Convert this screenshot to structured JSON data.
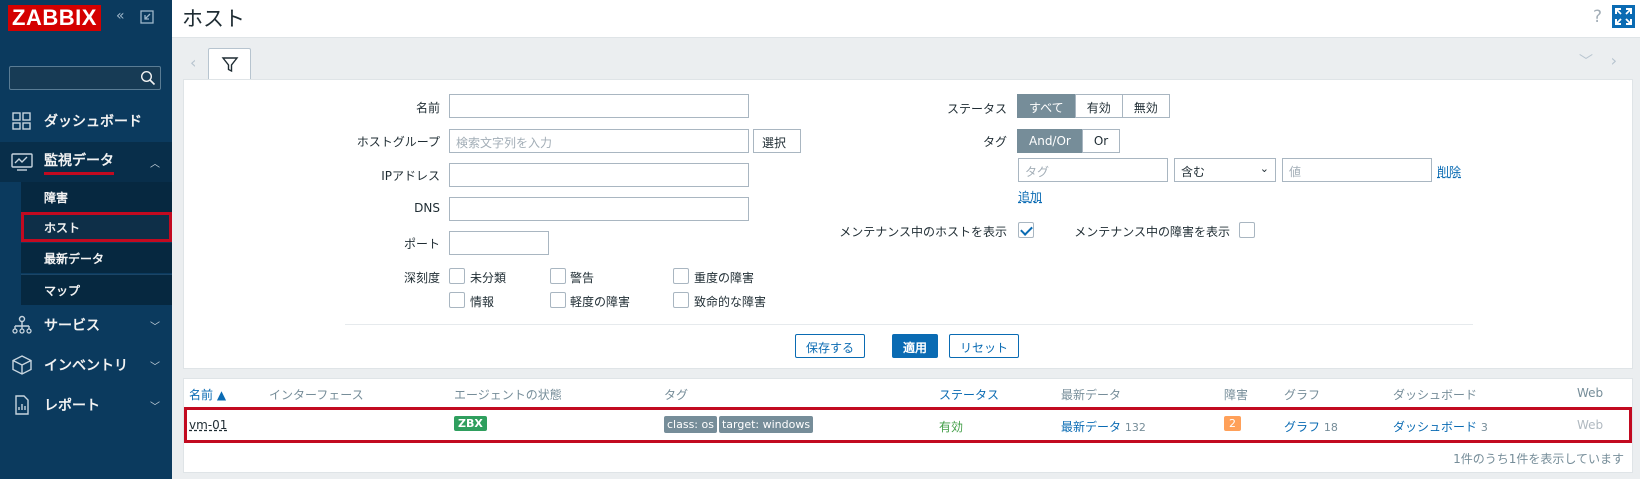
{
  "app": {
    "logo": "ZABBIX",
    "page_title": "ホスト",
    "help": "?"
  },
  "sidebar": {
    "items": [
      {
        "label": "ダッシュボード",
        "icon": "dashboard-icon"
      },
      {
        "label": "監視データ",
        "icon": "monitoring-icon",
        "expanded": true
      },
      {
        "label": "サービス",
        "icon": "services-icon"
      },
      {
        "label": "インベントリ",
        "icon": "inventory-icon"
      },
      {
        "label": "レポート",
        "icon": "reports-icon"
      }
    ],
    "sub_items": [
      {
        "label": "障害"
      },
      {
        "label": "ホスト",
        "current": true
      },
      {
        "label": "最新データ"
      },
      {
        "label": "マップ"
      }
    ]
  },
  "filter": {
    "name_label": "名前",
    "hostgroup_label": "ホストグループ",
    "hostgroup_placeholder": "検索文字列を入力",
    "select_button": "選択",
    "ip_label": "IPアドレス",
    "dns_label": "DNS",
    "port_label": "ポート",
    "severity_label": "深刻度",
    "severities": [
      "未分類",
      "警告",
      "重度の障害",
      "情報",
      "軽度の障害",
      "致命的な障害"
    ],
    "status_label": "ステータス",
    "status_options": [
      "すべて",
      "有効",
      "無効"
    ],
    "status_selected": "すべて",
    "tags_label": "タグ",
    "tag_ops": [
      "And/Or",
      "Or"
    ],
    "tag_op_selected": "And/Or",
    "tag_placeholder": "タグ",
    "tag_operator": "含む",
    "value_placeholder": "値",
    "remove_link": "削除",
    "add_link": "追加",
    "maint_hosts_label": "メンテナンス中のホストを表示",
    "maint_hosts_checked": true,
    "maint_problems_label": "メンテナンス中の障害を表示",
    "maint_problems_checked": false,
    "save_button": "保存する",
    "apply_button": "適用",
    "reset_button": "リセット"
  },
  "table": {
    "headers": [
      "名前 ▲",
      "インターフェース",
      "エージェントの状態",
      "タグ",
      "ステータス",
      "最新データ",
      "障害",
      "グラフ",
      "ダッシュボード",
      "Web"
    ],
    "row": {
      "name": "vm-01",
      "agent": "ZBX",
      "tags": [
        "class: os",
        "target: windows"
      ],
      "status": "有効",
      "latest_label": "最新データ",
      "latest_count": "132",
      "problems": "2",
      "graphs_label": "グラフ",
      "graphs_count": "18",
      "dash_label": "ダッシュボード",
      "dash_count": "3",
      "web": "Web"
    },
    "footer": "1件のうち1件を表示しています"
  },
  "colors": {
    "sidebar": "#0b3a5e",
    "accent": "#0a6bb3",
    "highlight": "#c20a20",
    "enabled": "#429e47"
  }
}
